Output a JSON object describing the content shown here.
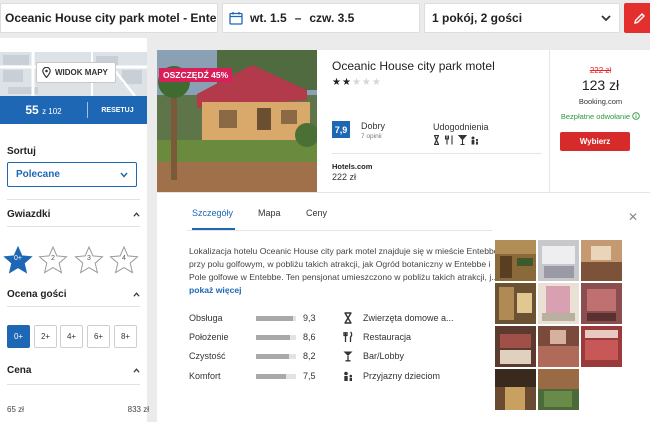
{
  "search": {
    "destination": "Oceanic House city park motel - Entebb",
    "date_from": "wt. 1.5",
    "date_sep": "–",
    "date_to": "czw. 3.5",
    "guests": "1 pokój, 2 gości"
  },
  "sidebar": {
    "map_button": "WIDOK MAPY",
    "result_count": "55",
    "result_total": "z 102",
    "reset": "RESETUJ",
    "sort_label": "Sortuj",
    "sort_value": "Polecane",
    "stars_label": "Gwiazdki",
    "stars": [
      "0+",
      "2",
      "3",
      "4"
    ],
    "rating_label": "Ocena gości",
    "rating_options": [
      "0+",
      "2+",
      "4+",
      "6+",
      "8+"
    ],
    "price_label": "Cena",
    "price_min": "65 zł",
    "price_max": "833 zł"
  },
  "hotel": {
    "badge": "OSZCZĘDŹ 45%",
    "name": "Oceanic House city park motel",
    "stars_filled": 2,
    "stars_total": 5,
    "score": "7,9",
    "score_label": "Dobry",
    "reviews": "7 opinii",
    "amenities_title": "Udogodnienia",
    "amenity_icons": [
      "hourglass-icon",
      "cutlery-icon",
      "cocktail-icon",
      "family-icon"
    ],
    "provider": "Hotels.com",
    "provider_price": "222 zł",
    "old_price": "222 zł",
    "best_price": "123 zł",
    "best_site": "Booking.com",
    "free_cancel": "Bezpłatne odwołanie",
    "choose": "Wybierz"
  },
  "details": {
    "tabs": [
      "Szczegóły",
      "Mapa",
      "Ceny"
    ],
    "description": "Lokalizacja hotelu Oceanic House city park motel znajduje się w mieście Entebbe, przy polu golfowym, w pobliżu takich atrakcji, jak Ogród botaniczny w Entebbe i Pole golfowe w Entebbe. Ten pensjonat umieszczono w pobliżu takich atrakcji, j...",
    "more": "pokaż więcej",
    "metrics": [
      {
        "label": "Obsługa",
        "value": "9,3",
        "score": 9.3
      },
      {
        "label": "Położenie",
        "value": "8,6",
        "score": 8.6
      },
      {
        "label": "Czystość",
        "value": "8,2",
        "score": 8.2
      },
      {
        "label": "Komfort",
        "value": "7,5",
        "score": 7.5
      }
    ],
    "facilities": [
      {
        "icon": "hourglass-icon",
        "label": "Zwierzęta domowe a..."
      },
      {
        "icon": "cutlery-icon",
        "label": "Restauracja"
      },
      {
        "icon": "cocktail-icon",
        "label": "Bar/Lobby"
      },
      {
        "icon": "family-icon",
        "label": "Przyjazny dzieciom"
      }
    ]
  },
  "colors": {
    "brand_blue": "#1e67b5",
    "cta_red": "#d72b2b",
    "badge_pink": "#d91f5a",
    "free_green": "#2c9b3d"
  }
}
